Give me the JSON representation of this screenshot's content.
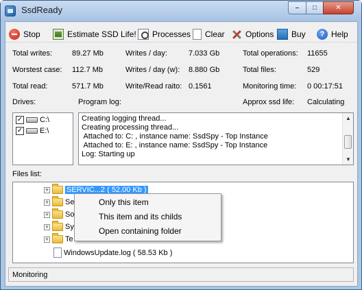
{
  "window": {
    "title": "SsdReady"
  },
  "toolbar": {
    "stop": "Stop",
    "estimate": "Estimate SSD Life!",
    "processes": "Processes",
    "clear": "Clear",
    "options": "Options",
    "buy": "Buy",
    "help": "Help"
  },
  "stats": {
    "total_writes_label": "Total writes:",
    "total_writes": "89.27 Mb",
    "worstest_label": "Worstest case:",
    "worstest": "112.7 Mb",
    "total_read_label": "Total read:",
    "total_read": "571.7 Mb",
    "writes_day_label": "Writes / day:",
    "writes_day": "7.033 Gb",
    "writes_day_w_label": "Writes / day (w):",
    "writes_day_w": "8.880 Gb",
    "raito_label": "Write/Read raito:",
    "raito": "0.1561",
    "total_ops_label": "Total operations:",
    "total_ops": "11655",
    "total_files_label": "Total files:",
    "total_files": "529",
    "monitoring_time_label": "Monitoring time:",
    "monitoring_time": "0 00:17:51",
    "ssd_life_label": "Approx ssd life:",
    "ssd_life": "Calculating"
  },
  "drives": {
    "label": "Drives:",
    "items": [
      {
        "name": "C:\\",
        "checked": true
      },
      {
        "name": "E:\\",
        "checked": true
      }
    ]
  },
  "log": {
    "label": "Program log:",
    "lines": [
      "Creating logging thread...",
      "Creating processing thread...",
      " Attached to: C: , instance name: SsdSpy - Top Instance",
      " Attached to: E: , instance name: SsdSpy - Top Instance",
      "Log: Starting up"
    ]
  },
  "files": {
    "label": "Files list:",
    "items": [
      {
        "label": "SERVIC...2 ( 52.00 Kb )",
        "type": "folder",
        "selected": true
      },
      {
        "label": "Se",
        "type": "folder"
      },
      {
        "label": "So",
        "type": "folder"
      },
      {
        "label": "Sy",
        "type": "folder"
      },
      {
        "label": "Te",
        "type": "folder"
      },
      {
        "label": "WindowsUpdate.log ( 58.53 Kb )",
        "type": "file"
      }
    ]
  },
  "context_menu": {
    "items": [
      "Only this item",
      "This item and its childs",
      "Open containing folder"
    ]
  },
  "status": {
    "text": "Monitoring"
  }
}
